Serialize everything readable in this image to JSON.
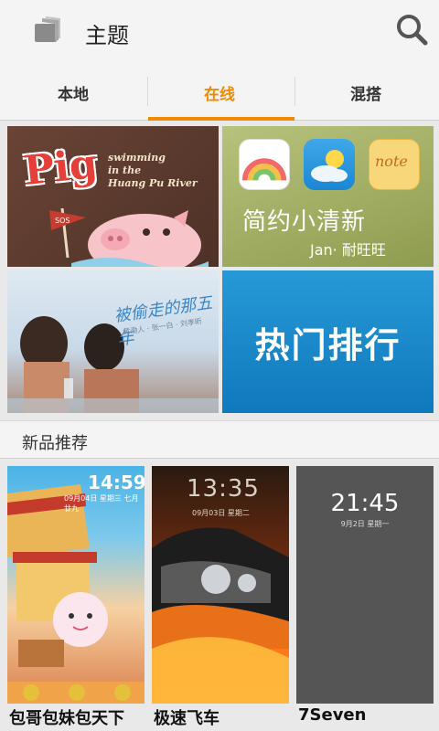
{
  "header": {
    "title": "主题",
    "app_icon": "theme-folder-icon",
    "search_icon": "search-icon"
  },
  "tabs": [
    {
      "label": "本地",
      "selected": false
    },
    {
      "label": "在线",
      "selected": true
    },
    {
      "label": "混搭",
      "selected": false
    }
  ],
  "colors": {
    "accent": "#f08a00",
    "hot_tile": "#1b86cc"
  },
  "banners": {
    "pig": {
      "word": "Pig",
      "subtitle": [
        "swimming",
        "in the",
        "Huang Pu River"
      ],
      "flag_text": "SOS"
    },
    "fresh": {
      "title": "简约小清新",
      "subtitle": "Jan· 耐旺旺",
      "note_label": "note"
    },
    "couple": {
      "caption": "被偷走的那五年",
      "small": "黄渤人 · 张一白 · 刘孝昕"
    },
    "hot": {
      "label": "热门排行"
    }
  },
  "section": {
    "title": "新品推荐"
  },
  "themes": [
    {
      "name": "包哥包妹包天下",
      "time": "14:59",
      "date": "09月04日 星期三 七月廿九"
    },
    {
      "name": "极速飞车",
      "time": "13:35",
      "date": "09月03日 星期二"
    },
    {
      "name": "7Seven",
      "time": "21:45",
      "date": "9月2日 星期一"
    }
  ]
}
